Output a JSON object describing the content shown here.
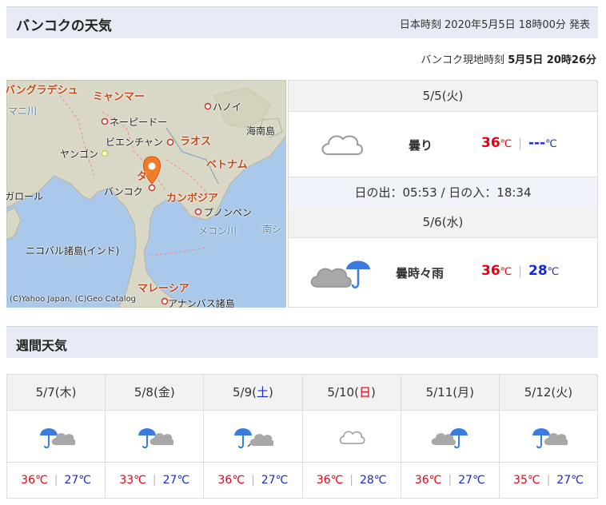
{
  "header": {
    "title": "バンコクの天気",
    "issued": "日本時刻 2020年5月5日 18時00分 発表"
  },
  "local_time": {
    "label": "バンコク現地時刻",
    "value": "5月5日 20時26分"
  },
  "map": {
    "labels": {
      "bangladesh": "バングラデシュ",
      "myanmar": "ミャンマー",
      "hanoi": "ハノイ",
      "naypyidaw": "ネーピードー",
      "hainan": "海南島",
      "vientiane": "ビエンチャン",
      "laos": "ラオス",
      "yangon": "ヤンゴン",
      "vietnam": "ベトナム",
      "thai": "タ",
      "bangalore": "ガロール",
      "bangkok": "バンコク",
      "cambodia": "カンボジア",
      "phnompenh": "プノンペン",
      "mekong": "メコン川",
      "southsea": "南シ",
      "nicobar": "ニコバル諸島(インド)",
      "malaysia": "マレーシア",
      "anambas": "アナンバス諸島",
      "ganges": "マニ川",
      "copyright": "(C)Yahoo Japan, (C)Geo Catalog"
    }
  },
  "today": {
    "date": "5/5(火)",
    "weather": "曇り",
    "high": "36",
    "low": "---",
    "unit": "℃",
    "sun": "日の出：05:53 / 日の入：18:34"
  },
  "tomorrow": {
    "date": "5/6(水)",
    "weather": "曇時々雨",
    "high": "36",
    "low": "28",
    "unit": "℃"
  },
  "weekly": {
    "title": "週間天気",
    "days": [
      {
        "md": "5/7(",
        "wd": "木",
        "close": ")",
        "icon": "umbrella-cloud-icon",
        "high": "36℃",
        "low": "27℃"
      },
      {
        "md": "5/8(",
        "wd": "金",
        "close": ")",
        "icon": "umbrella-cloud-icon",
        "high": "33℃",
        "low": "27℃"
      },
      {
        "md": "5/9(",
        "wd": "土",
        "close": ")",
        "icon": "umbrella-then-cloud-icon",
        "high": "36℃",
        "low": "27℃"
      },
      {
        "md": "5/10(",
        "wd": "日",
        "close": ")",
        "icon": "cloud-icon",
        "high": "36℃",
        "low": "28℃"
      },
      {
        "md": "5/11(",
        "wd": "月",
        "close": ")",
        "icon": "cloud-umbrella-icon",
        "high": "36℃",
        "low": "27℃"
      },
      {
        "md": "5/12(",
        "wd": "火",
        "close": ")",
        "icon": "umbrella-cloud-icon",
        "high": "35℃",
        "low": "27℃"
      }
    ]
  },
  "colors": {
    "high": "#e60012",
    "low": "#1a2bcb",
    "header_bg": "#e6ebf5",
    "umbrella": "#3b7be0",
    "cloud": "#b5b5b5"
  }
}
